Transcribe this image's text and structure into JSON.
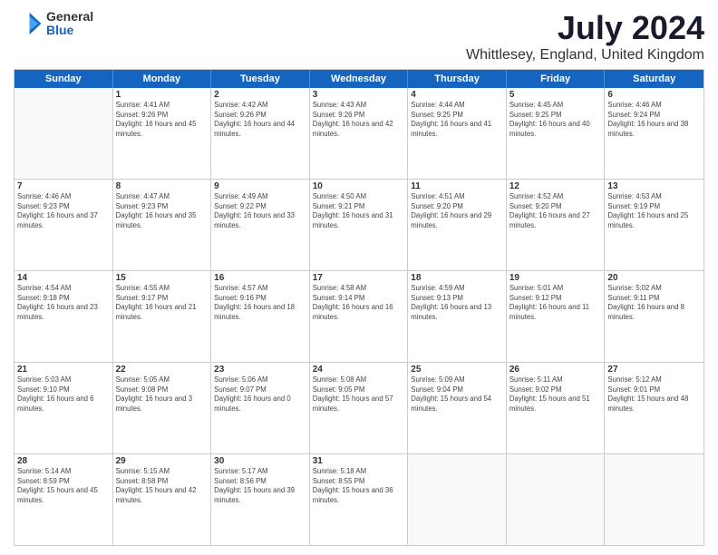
{
  "header": {
    "logo_general": "General",
    "logo_blue": "Blue",
    "title": "July 2024",
    "subtitle": "Whittlesey, England, United Kingdom"
  },
  "days_of_week": [
    "Sunday",
    "Monday",
    "Tuesday",
    "Wednesday",
    "Thursday",
    "Friday",
    "Saturday"
  ],
  "weeks": [
    [
      {
        "day": "",
        "empty": true
      },
      {
        "day": "1",
        "sunrise": "Sunrise: 4:41 AM",
        "sunset": "Sunset: 9:26 PM",
        "daylight": "Daylight: 16 hours and 45 minutes."
      },
      {
        "day": "2",
        "sunrise": "Sunrise: 4:42 AM",
        "sunset": "Sunset: 9:26 PM",
        "daylight": "Daylight: 16 hours and 44 minutes."
      },
      {
        "day": "3",
        "sunrise": "Sunrise: 4:43 AM",
        "sunset": "Sunset: 9:26 PM",
        "daylight": "Daylight: 16 hours and 42 minutes."
      },
      {
        "day": "4",
        "sunrise": "Sunrise: 4:44 AM",
        "sunset": "Sunset: 9:25 PM",
        "daylight": "Daylight: 16 hours and 41 minutes."
      },
      {
        "day": "5",
        "sunrise": "Sunrise: 4:45 AM",
        "sunset": "Sunset: 9:25 PM",
        "daylight": "Daylight: 16 hours and 40 minutes."
      },
      {
        "day": "6",
        "sunrise": "Sunrise: 4:46 AM",
        "sunset": "Sunset: 9:24 PM",
        "daylight": "Daylight: 16 hours and 38 minutes."
      }
    ],
    [
      {
        "day": "7",
        "sunrise": "Sunrise: 4:46 AM",
        "sunset": "Sunset: 9:23 PM",
        "daylight": "Daylight: 16 hours and 37 minutes."
      },
      {
        "day": "8",
        "sunrise": "Sunrise: 4:47 AM",
        "sunset": "Sunset: 9:23 PM",
        "daylight": "Daylight: 16 hours and 35 minutes."
      },
      {
        "day": "9",
        "sunrise": "Sunrise: 4:49 AM",
        "sunset": "Sunset: 9:22 PM",
        "daylight": "Daylight: 16 hours and 33 minutes."
      },
      {
        "day": "10",
        "sunrise": "Sunrise: 4:50 AM",
        "sunset": "Sunset: 9:21 PM",
        "daylight": "Daylight: 16 hours and 31 minutes."
      },
      {
        "day": "11",
        "sunrise": "Sunrise: 4:51 AM",
        "sunset": "Sunset: 9:20 PM",
        "daylight": "Daylight: 16 hours and 29 minutes."
      },
      {
        "day": "12",
        "sunrise": "Sunrise: 4:52 AM",
        "sunset": "Sunset: 9:20 PM",
        "daylight": "Daylight: 16 hours and 27 minutes."
      },
      {
        "day": "13",
        "sunrise": "Sunrise: 4:53 AM",
        "sunset": "Sunset: 9:19 PM",
        "daylight": "Daylight: 16 hours and 25 minutes."
      }
    ],
    [
      {
        "day": "14",
        "sunrise": "Sunrise: 4:54 AM",
        "sunset": "Sunset: 9:18 PM",
        "daylight": "Daylight: 16 hours and 23 minutes."
      },
      {
        "day": "15",
        "sunrise": "Sunrise: 4:55 AM",
        "sunset": "Sunset: 9:17 PM",
        "daylight": "Daylight: 16 hours and 21 minutes."
      },
      {
        "day": "16",
        "sunrise": "Sunrise: 4:57 AM",
        "sunset": "Sunset: 9:16 PM",
        "daylight": "Daylight: 16 hours and 18 minutes."
      },
      {
        "day": "17",
        "sunrise": "Sunrise: 4:58 AM",
        "sunset": "Sunset: 9:14 PM",
        "daylight": "Daylight: 16 hours and 16 minutes."
      },
      {
        "day": "18",
        "sunrise": "Sunrise: 4:59 AM",
        "sunset": "Sunset: 9:13 PM",
        "daylight": "Daylight: 16 hours and 13 minutes."
      },
      {
        "day": "19",
        "sunrise": "Sunrise: 5:01 AM",
        "sunset": "Sunset: 9:12 PM",
        "daylight": "Daylight: 16 hours and 11 minutes."
      },
      {
        "day": "20",
        "sunrise": "Sunrise: 5:02 AM",
        "sunset": "Sunset: 9:11 PM",
        "daylight": "Daylight: 16 hours and 8 minutes."
      }
    ],
    [
      {
        "day": "21",
        "sunrise": "Sunrise: 5:03 AM",
        "sunset": "Sunset: 9:10 PM",
        "daylight": "Daylight: 16 hours and 6 minutes."
      },
      {
        "day": "22",
        "sunrise": "Sunrise: 5:05 AM",
        "sunset": "Sunset: 9:08 PM",
        "daylight": "Daylight: 16 hours and 3 minutes."
      },
      {
        "day": "23",
        "sunrise": "Sunrise: 5:06 AM",
        "sunset": "Sunset: 9:07 PM",
        "daylight": "Daylight: 16 hours and 0 minutes."
      },
      {
        "day": "24",
        "sunrise": "Sunrise: 5:08 AM",
        "sunset": "Sunset: 9:05 PM",
        "daylight": "Daylight: 15 hours and 57 minutes."
      },
      {
        "day": "25",
        "sunrise": "Sunrise: 5:09 AM",
        "sunset": "Sunset: 9:04 PM",
        "daylight": "Daylight: 15 hours and 54 minutes."
      },
      {
        "day": "26",
        "sunrise": "Sunrise: 5:11 AM",
        "sunset": "Sunset: 9:02 PM",
        "daylight": "Daylight: 15 hours and 51 minutes."
      },
      {
        "day": "27",
        "sunrise": "Sunrise: 5:12 AM",
        "sunset": "Sunset: 9:01 PM",
        "daylight": "Daylight: 15 hours and 48 minutes."
      }
    ],
    [
      {
        "day": "28",
        "sunrise": "Sunrise: 5:14 AM",
        "sunset": "Sunset: 8:59 PM",
        "daylight": "Daylight: 15 hours and 45 minutes."
      },
      {
        "day": "29",
        "sunrise": "Sunrise: 5:15 AM",
        "sunset": "Sunset: 8:58 PM",
        "daylight": "Daylight: 15 hours and 42 minutes."
      },
      {
        "day": "30",
        "sunrise": "Sunrise: 5:17 AM",
        "sunset": "Sunset: 8:56 PM",
        "daylight": "Daylight: 15 hours and 39 minutes."
      },
      {
        "day": "31",
        "sunrise": "Sunrise: 5:18 AM",
        "sunset": "Sunset: 8:55 PM",
        "daylight": "Daylight: 15 hours and 36 minutes."
      },
      {
        "day": "",
        "empty": true
      },
      {
        "day": "",
        "empty": true
      },
      {
        "day": "",
        "empty": true
      }
    ]
  ]
}
